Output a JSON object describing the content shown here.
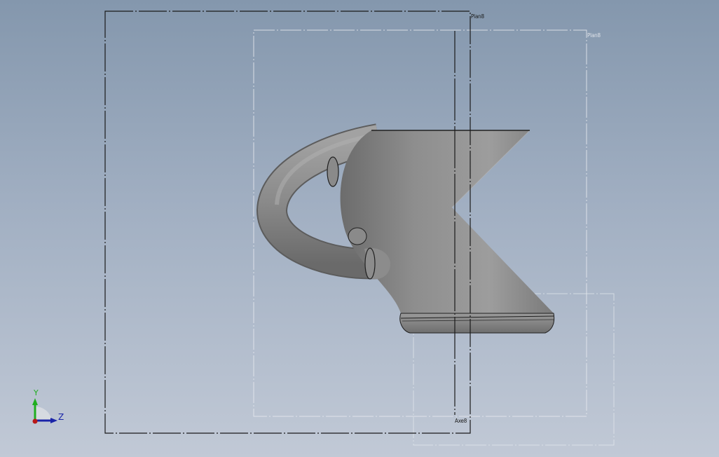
{
  "viewport": {
    "background_top": "#8497ad",
    "background_bottom": "#c1c9d6"
  },
  "ref_planes": {
    "front_plane_label": "Plan8",
    "back_plane_label": "Plan8",
    "front_plane_color": "#1a1a1a",
    "back_plane_color": "#e6e9ee"
  },
  "axis": {
    "label": "Axe8",
    "color": "#1a1a1a"
  },
  "part": {
    "body_color": "#8a8a8a",
    "edge_color": "#202020"
  },
  "triad": {
    "y_label": "Y",
    "z_label": "Z",
    "y_color": "#1fae1f",
    "z_color": "#1a24a8",
    "x_color": "#b81818"
  }
}
